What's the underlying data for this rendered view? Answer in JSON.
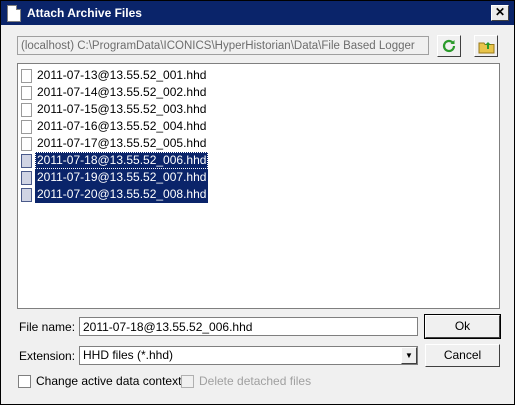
{
  "window": {
    "title": "Attach Archive Files",
    "close_label": "✕"
  },
  "toolbar": {
    "path": "(localhost) C:\\ProgramData\\ICONICS\\HyperHistorian\\Data\\File Based Logger"
  },
  "files": [
    {
      "name": "2011-07-13@13.55.52_001.hhd",
      "selected": false
    },
    {
      "name": "2011-07-14@13.55.52_002.hhd",
      "selected": false
    },
    {
      "name": "2011-07-15@13.55.52_003.hhd",
      "selected": false
    },
    {
      "name": "2011-07-16@13.55.52_004.hhd",
      "selected": false
    },
    {
      "name": "2011-07-17@13.55.52_005.hhd",
      "selected": false
    },
    {
      "name": "2011-07-18@13.55.52_006.hhd",
      "selected": true
    },
    {
      "name": "2011-07-19@13.55.52_007.hhd",
      "selected": true
    },
    {
      "name": "2011-07-20@13.55.52_008.hhd",
      "selected": true
    }
  ],
  "form": {
    "file_name_label": "File name:",
    "file_name_value": "2011-07-18@13.55.52_006.hhd",
    "extension_label": "Extension:",
    "extension_value": "HHD files (*.hhd)"
  },
  "buttons": {
    "ok": "Ok",
    "cancel": "Cancel"
  },
  "options": {
    "change_context_label": "Change active data context",
    "delete_detached_label": "Delete detached files"
  },
  "colors": {
    "title_bar": "#0a246a",
    "selection": "#0a246a"
  }
}
